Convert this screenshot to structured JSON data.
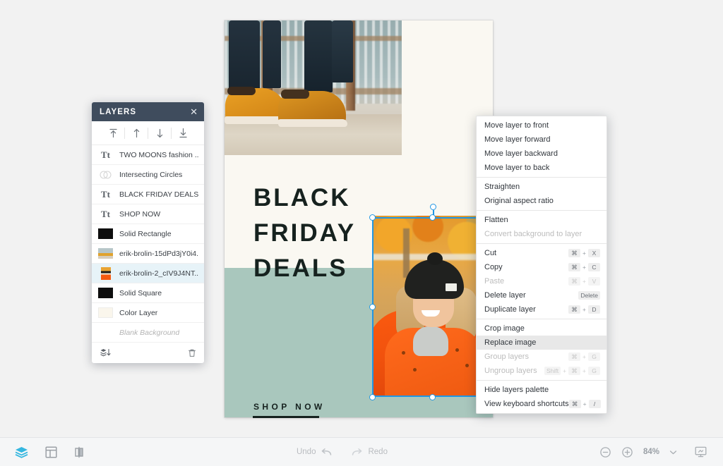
{
  "app": {
    "canvas": {
      "headline_lines": [
        "BLACK",
        "FRIDAY",
        "DEALS"
      ],
      "cta_text": "SHOP NOW",
      "bg_color": "#faf8f2",
      "band_color": "#a9c7bd",
      "text_color": "#16221f"
    }
  },
  "layers_panel": {
    "title": "LAYERS",
    "close_icon": "close-icon",
    "arrange": [
      {
        "name": "move-to-front",
        "icon": "arrow-up-to-line-icon"
      },
      {
        "name": "move-forward",
        "icon": "arrow-up-icon"
      },
      {
        "name": "move-backward",
        "icon": "arrow-down-icon"
      },
      {
        "name": "move-to-back",
        "icon": "arrow-down-to-line-icon"
      }
    ],
    "layers": [
      {
        "label": "TWO MOONS fashion ...",
        "thumb": "text",
        "selected": false,
        "dim": false
      },
      {
        "label": "Intersecting Circles",
        "thumb": "shape",
        "selected": false,
        "dim": false
      },
      {
        "label": "BLACK FRIDAY DEALS",
        "thumb": "text",
        "selected": false,
        "dim": false
      },
      {
        "label": "SHOP NOW",
        "thumb": "text",
        "selected": false,
        "dim": false
      },
      {
        "label": "Solid Rectangle",
        "thumb": "black",
        "selected": false,
        "dim": false
      },
      {
        "label": "erik-brolin-15dPd3jY0i4...",
        "thumb": "photo-shoes",
        "selected": false,
        "dim": false
      },
      {
        "label": "erik-brolin-2_cIV9J4NT...",
        "thumb": "photo-girl",
        "selected": true,
        "dim": false
      },
      {
        "label": "Solid Square",
        "thumb": "black",
        "selected": false,
        "dim": false
      },
      {
        "label": "Color Layer",
        "thumb": "cream",
        "selected": false,
        "dim": false
      },
      {
        "label": "Blank Background",
        "thumb": "none",
        "selected": false,
        "dim": true
      }
    ],
    "footer": [
      {
        "name": "merge-layers-icon"
      },
      {
        "name": "trash-icon"
      }
    ]
  },
  "context_menu": {
    "items": [
      {
        "label": "Move layer to front",
        "keys": [],
        "disabled": false,
        "hover": false,
        "sep_after": false
      },
      {
        "label": "Move layer forward",
        "keys": [],
        "disabled": false,
        "hover": false,
        "sep_after": false
      },
      {
        "label": "Move layer backward",
        "keys": [],
        "disabled": false,
        "hover": false,
        "sep_after": false
      },
      {
        "label": "Move layer to back",
        "keys": [],
        "disabled": false,
        "hover": false,
        "sep_after": true
      },
      {
        "label": "Straighten",
        "keys": [],
        "disabled": false,
        "hover": false,
        "sep_after": false
      },
      {
        "label": "Original aspect ratio",
        "keys": [],
        "disabled": false,
        "hover": false,
        "sep_after": true
      },
      {
        "label": "Flatten",
        "keys": [],
        "disabled": false,
        "hover": false,
        "sep_after": false
      },
      {
        "label": "Convert background to layer",
        "keys": [],
        "disabled": true,
        "hover": false,
        "sep_after": true
      },
      {
        "label": "Cut",
        "keys": [
          "⌘",
          "X"
        ],
        "disabled": false,
        "hover": false,
        "sep_after": false
      },
      {
        "label": "Copy",
        "keys": [
          "⌘",
          "C"
        ],
        "disabled": false,
        "hover": false,
        "sep_after": false
      },
      {
        "label": "Paste",
        "keys": [
          "⌘",
          "V"
        ],
        "disabled": true,
        "hover": false,
        "sep_after": false
      },
      {
        "label": "Delete layer",
        "keys": [
          "Delete"
        ],
        "disabled": false,
        "hover": false,
        "sep_after": false
      },
      {
        "label": "Duplicate layer",
        "keys": [
          "⌘",
          "D"
        ],
        "disabled": false,
        "hover": false,
        "sep_after": true
      },
      {
        "label": "Crop image",
        "keys": [],
        "disabled": false,
        "hover": false,
        "sep_after": false
      },
      {
        "label": "Replace image",
        "keys": [],
        "disabled": false,
        "hover": true,
        "sep_after": false
      },
      {
        "label": "Group layers",
        "keys": [
          "⌘",
          "G"
        ],
        "disabled": true,
        "hover": false,
        "sep_after": false
      },
      {
        "label": "Ungroup layers",
        "keys": [
          "Shift",
          "⌘",
          "G"
        ],
        "disabled": true,
        "hover": false,
        "sep_after": true
      },
      {
        "label": "Hide layers palette",
        "keys": [],
        "disabled": false,
        "hover": false,
        "sep_after": false
      },
      {
        "label": "View keyboard shortcuts",
        "keys": [
          "⌘",
          "/"
        ],
        "disabled": false,
        "hover": false,
        "sep_after": false
      }
    ]
  },
  "bottom_bar": {
    "tools": [
      {
        "name": "layers-tool-icon",
        "active": true
      },
      {
        "name": "grid-tool-icon",
        "active": false
      },
      {
        "name": "flip-tool-icon",
        "active": false
      }
    ],
    "undo_label": "Undo",
    "redo_label": "Redo",
    "zoom_out_icon": "minus-circle-icon",
    "zoom_in_icon": "plus-circle-icon",
    "zoom_level": "84%",
    "zoom_caret_icon": "chevron-down-icon",
    "present_icon": "present-screen-icon"
  }
}
